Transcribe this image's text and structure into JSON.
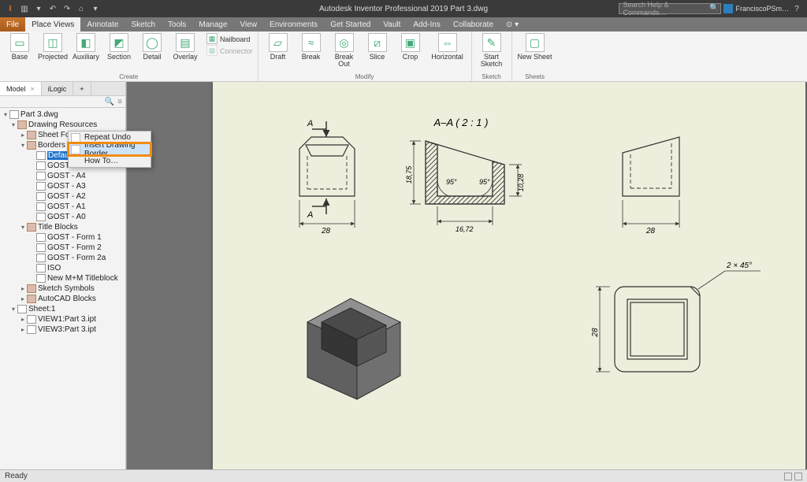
{
  "app": {
    "title": "Autodesk Inventor Professional 2019   Part 3.dwg",
    "search_placeholder": "Search Help & Commands…",
    "user": "FranciscoPSm…"
  },
  "ribbon_tabs": [
    "File",
    "Place Views",
    "Annotate",
    "Sketch",
    "Tools",
    "Manage",
    "View",
    "Environments",
    "Get Started",
    "Vault",
    "Add-Ins",
    "Collaborate"
  ],
  "active_ribbon_tab": 1,
  "ribbon": {
    "create": {
      "label": "Create",
      "buttons": {
        "base": "Base",
        "projected": "Projected",
        "auxiliary": "Auxiliary",
        "section": "Section",
        "detail": "Detail",
        "overlay": "Overlay"
      },
      "small": {
        "nailboard": "Nailboard",
        "connector": "Connector"
      }
    },
    "modify": {
      "label": "Modify",
      "buttons": {
        "draft": "Draft",
        "break": "Break",
        "breakout": "Break Out",
        "slice": "Slice",
        "crop": "Crop",
        "horizontal": "Horizontal"
      }
    },
    "sketch": {
      "label": "Sketch",
      "button": "Start\nSketch"
    },
    "sheets": {
      "label": "Sheets",
      "button": "New Sheet"
    }
  },
  "browser": {
    "tabs": [
      "Model",
      "iLogic"
    ],
    "active_tab": 0,
    "root": "Part 3.dwg",
    "nodes": [
      {
        "d": 0,
        "exp": "▾",
        "ico": "file",
        "label": "Part 3.dwg"
      },
      {
        "d": 1,
        "exp": "▾",
        "ico": "folder",
        "label": "Drawing Resources"
      },
      {
        "d": 2,
        "exp": "▸",
        "ico": "folder",
        "label": "Sheet Formats"
      },
      {
        "d": 2,
        "exp": "▾",
        "ico": "folder",
        "label": "Borders"
      },
      {
        "d": 3,
        "exp": "",
        "ico": "file",
        "label": "Default Border",
        "selected": true
      },
      {
        "d": 3,
        "exp": "",
        "ico": "file",
        "label": "GOST - Border"
      },
      {
        "d": 3,
        "exp": "",
        "ico": "file",
        "label": "GOST - A4"
      },
      {
        "d": 3,
        "exp": "",
        "ico": "file",
        "label": "GOST - A3"
      },
      {
        "d": 3,
        "exp": "",
        "ico": "file",
        "label": "GOST - A2"
      },
      {
        "d": 3,
        "exp": "",
        "ico": "file",
        "label": "GOST - A1"
      },
      {
        "d": 3,
        "exp": "",
        "ico": "file",
        "label": "GOST - A0"
      },
      {
        "d": 2,
        "exp": "▾",
        "ico": "folder",
        "label": "Title Blocks"
      },
      {
        "d": 3,
        "exp": "",
        "ico": "file",
        "label": "GOST - Form 1"
      },
      {
        "d": 3,
        "exp": "",
        "ico": "file",
        "label": "GOST - Form 2"
      },
      {
        "d": 3,
        "exp": "",
        "ico": "file",
        "label": "GOST - Form 2a"
      },
      {
        "d": 3,
        "exp": "",
        "ico": "file",
        "label": "ISO"
      },
      {
        "d": 3,
        "exp": "",
        "ico": "file",
        "label": "New M+M Titleblock"
      },
      {
        "d": 2,
        "exp": "▸",
        "ico": "folder",
        "label": "Sketch Symbols"
      },
      {
        "d": 2,
        "exp": "▸",
        "ico": "folder",
        "label": "AutoCAD Blocks"
      },
      {
        "d": 1,
        "exp": "▾",
        "ico": "file",
        "label": "Sheet:1"
      },
      {
        "d": 2,
        "exp": "▸",
        "ico": "file",
        "label": "VIEW1:Part 3.ipt"
      },
      {
        "d": 2,
        "exp": "▸",
        "ico": "file",
        "label": "VIEW3:Part 3.ipt"
      }
    ]
  },
  "context_menu": {
    "items": [
      {
        "label": "Repeat Undo",
        "icon": true
      },
      {
        "label": "Insert Drawing Border…",
        "icon": true,
        "highlight": true,
        "boxed": true
      },
      {
        "label": "How To…",
        "icon": false
      }
    ]
  },
  "status": {
    "text": "Ready"
  },
  "drawing": {
    "section_label": "A–A ( 2 : 1 )",
    "dim_top_28": "28",
    "dim_bottom_28": "28",
    "dim_1672": "16,72",
    "dim_1875": "18,75",
    "dim_1028": "10,28",
    "angle_left": "95°",
    "angle_right": "95°",
    "arrow_A1": "A",
    "arrow_A2": "A",
    "chamfer": "2 × 45°",
    "dim_right_28": "28"
  }
}
